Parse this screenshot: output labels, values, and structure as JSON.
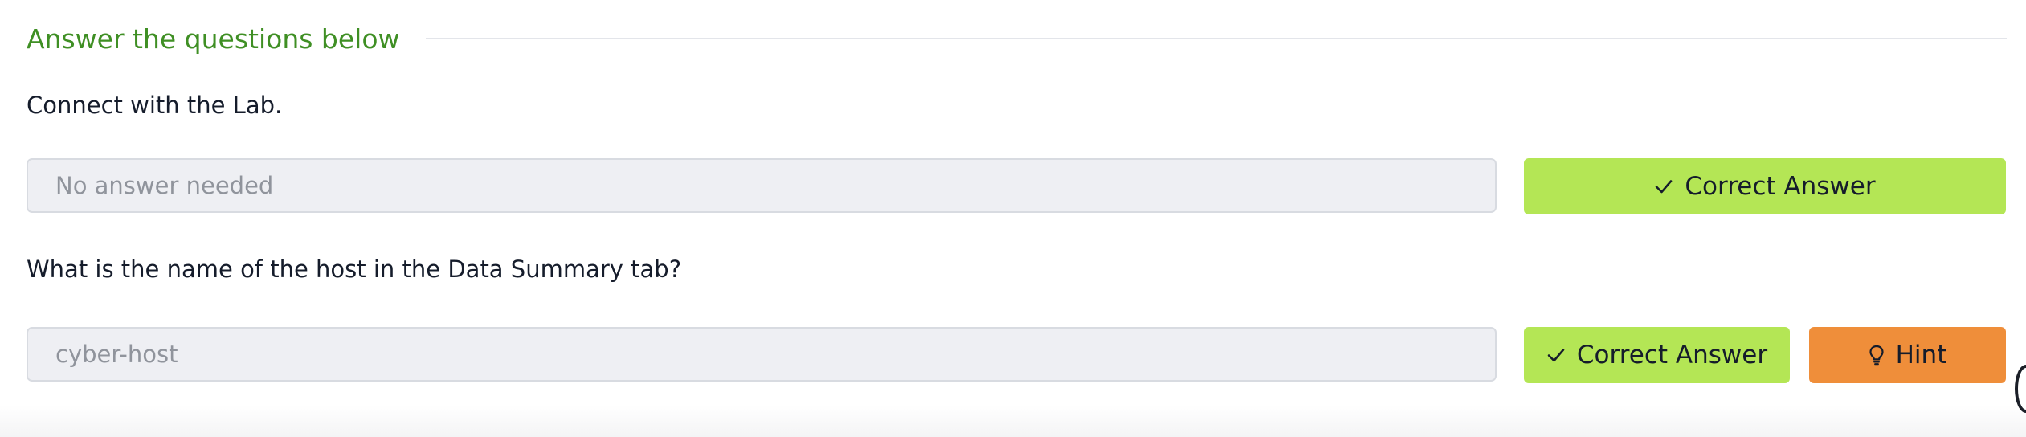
{
  "section": {
    "title": "Answer the questions below"
  },
  "questions": [
    {
      "text": "Connect with the Lab.",
      "answer": "No answer needed",
      "submit_label": "Correct Answer"
    },
    {
      "text": "What is the name of the host in the Data Summary tab?",
      "answer": "cyber-host",
      "submit_label": "Correct Answer",
      "hint_label": "Hint"
    }
  ],
  "colors": {
    "section_title": "#3f8f24",
    "correct_button": "#b4e655",
    "hint_button": "#ef8e3a"
  },
  "icons": {
    "correct": "check-icon",
    "hint": "lightbulb-icon"
  }
}
